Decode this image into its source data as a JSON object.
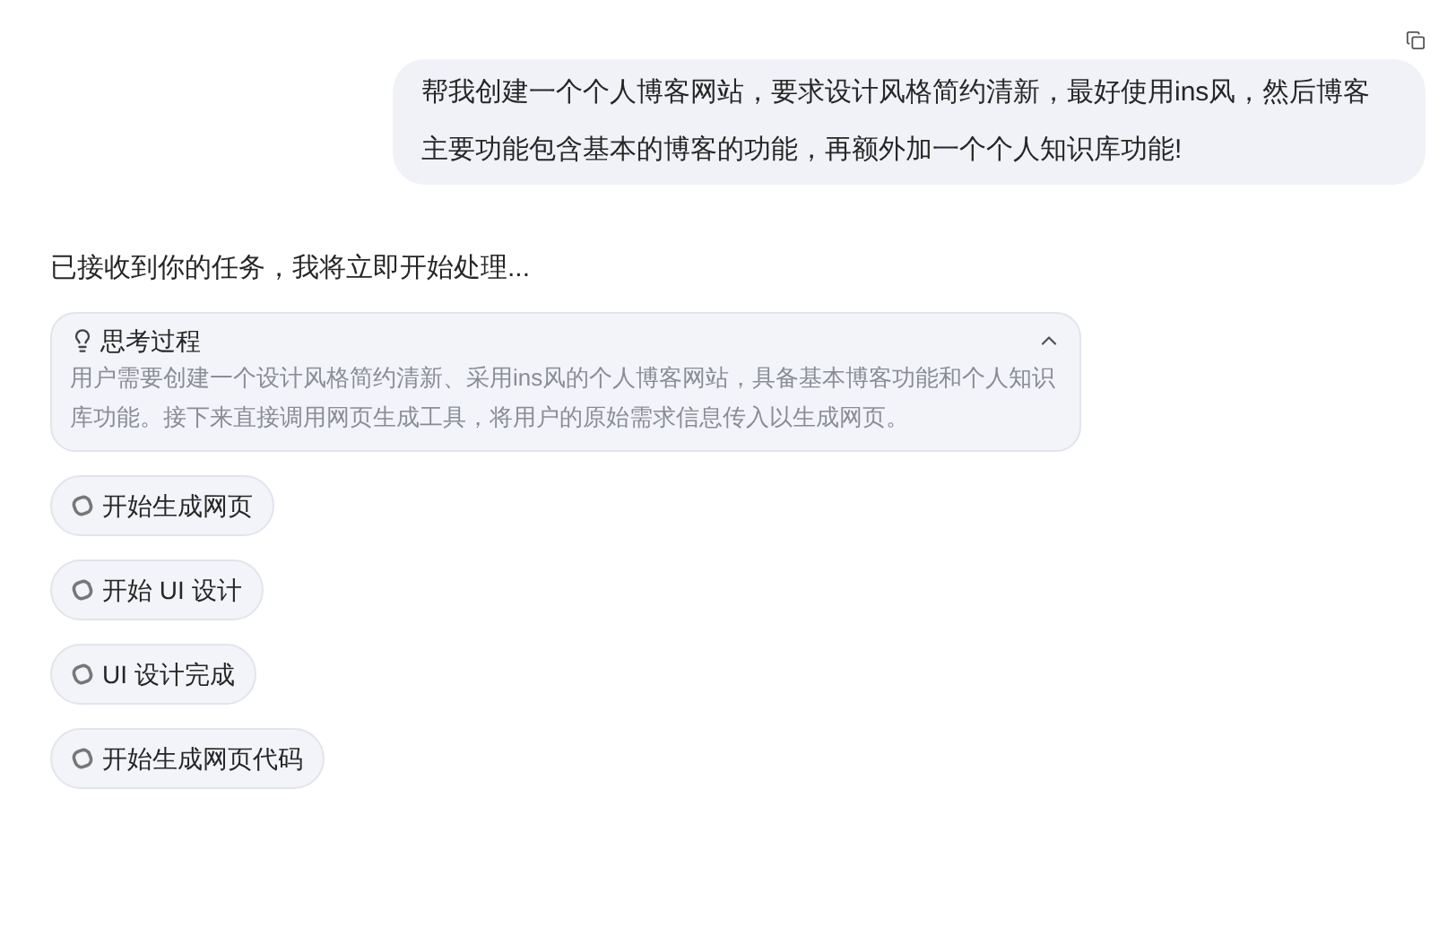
{
  "user_message": {
    "text": "帮我创建一个个人博客网站，要求设计风格简约清新，最好使用ins风，然后博客主要功能包含基本的博客的功能，再额外加一个个人知识库功能!"
  },
  "reply": {
    "text": "已接收到你的任务，我将立即开始处理..."
  },
  "thinking": {
    "title": "思考过程",
    "expanded": true,
    "text": "用户需要创建一个设计风格简约清新、采用ins风的个人博客网站，具备基本博客功能和个人知识库功能。接下来直接调用网页生成工具，将用户的原始需求信息传入以生成网页。"
  },
  "steps": [
    {
      "label": "开始生成网页"
    },
    {
      "label": "开始 UI 设计"
    },
    {
      "label": "UI 设计完成"
    },
    {
      "label": "开始生成网页代码"
    }
  ]
}
